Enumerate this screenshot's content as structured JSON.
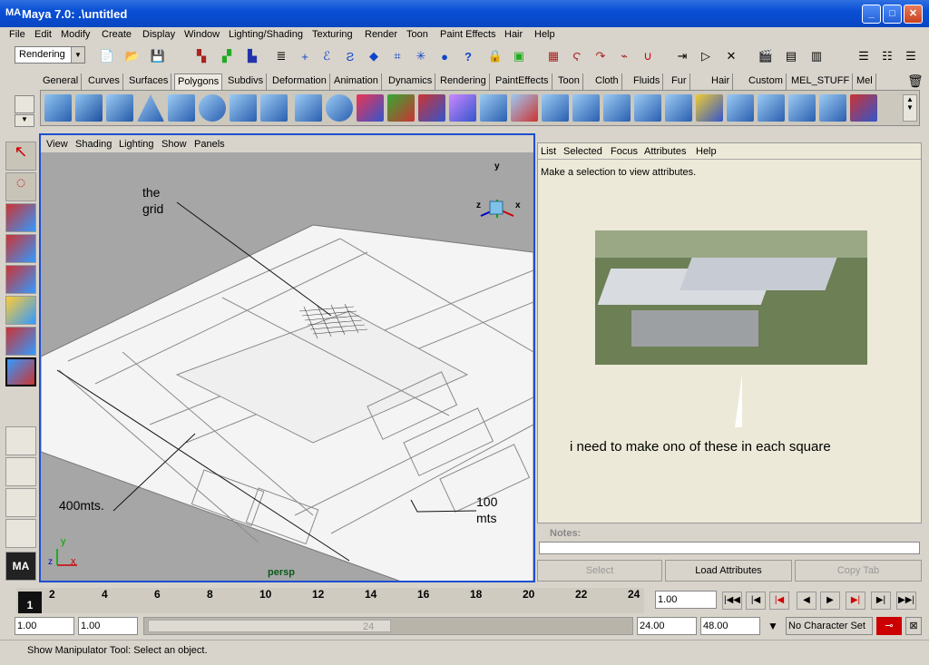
{
  "window": {
    "title": "Maya 7.0: .\\untitled",
    "app_icon": "MA"
  },
  "menu": [
    "File",
    "Edit",
    "Modify",
    "Create",
    "Display",
    "Window",
    "Lighting/Shading",
    "Texturing",
    "Render",
    "Toon",
    "Paint Effects",
    "Hair",
    "Help"
  ],
  "toolbar": {
    "mode": "Rendering"
  },
  "shelf_tabs": [
    "General",
    "Curves",
    "Surfaces",
    "Polygons",
    "Subdivs",
    "Deformation",
    "Animation",
    "Dynamics",
    "Rendering",
    "PaintEffects",
    "Toon",
    "Cloth",
    "Fluids",
    "Fur",
    "Hair",
    "Custom",
    "MEL_STUFF",
    "Mel"
  ],
  "shelf_active": "Polygons",
  "viewport": {
    "menu": [
      "View",
      "Shading",
      "Lighting",
      "Show",
      "Panels"
    ],
    "camera": "persp",
    "annotations": {
      "grid_line1": "the",
      "grid_line2": "grid",
      "left_dim": "400mts.",
      "right_dim_line1": "100",
      "right_dim_line2": "mts"
    },
    "axis": {
      "x": "x",
      "y": "y",
      "z": "z"
    }
  },
  "attr": {
    "menu": [
      "List",
      "Selected",
      "Focus",
      "Attributes",
      "Help"
    ],
    "message": "Make a selection to view attributes.",
    "comment": "i need to make ono of these in each square",
    "notes_label": "Notes:",
    "buttons": {
      "select": "Select",
      "load": "Load Attributes",
      "copy": "Copy Tab"
    }
  },
  "timeline": {
    "ticks": [
      "2",
      "4",
      "6",
      "8",
      "10",
      "12",
      "14",
      "16",
      "18",
      "20",
      "22",
      "24"
    ],
    "current": "1",
    "current_time": "1.00"
  },
  "range": {
    "start": "1.00",
    "start2": "1.00",
    "range_end_label": "24",
    "end": "24.00",
    "end2": "48.00",
    "char_set": "No Character Set"
  },
  "status": {
    "text": "Show Manipulator Tool: Select an object."
  }
}
